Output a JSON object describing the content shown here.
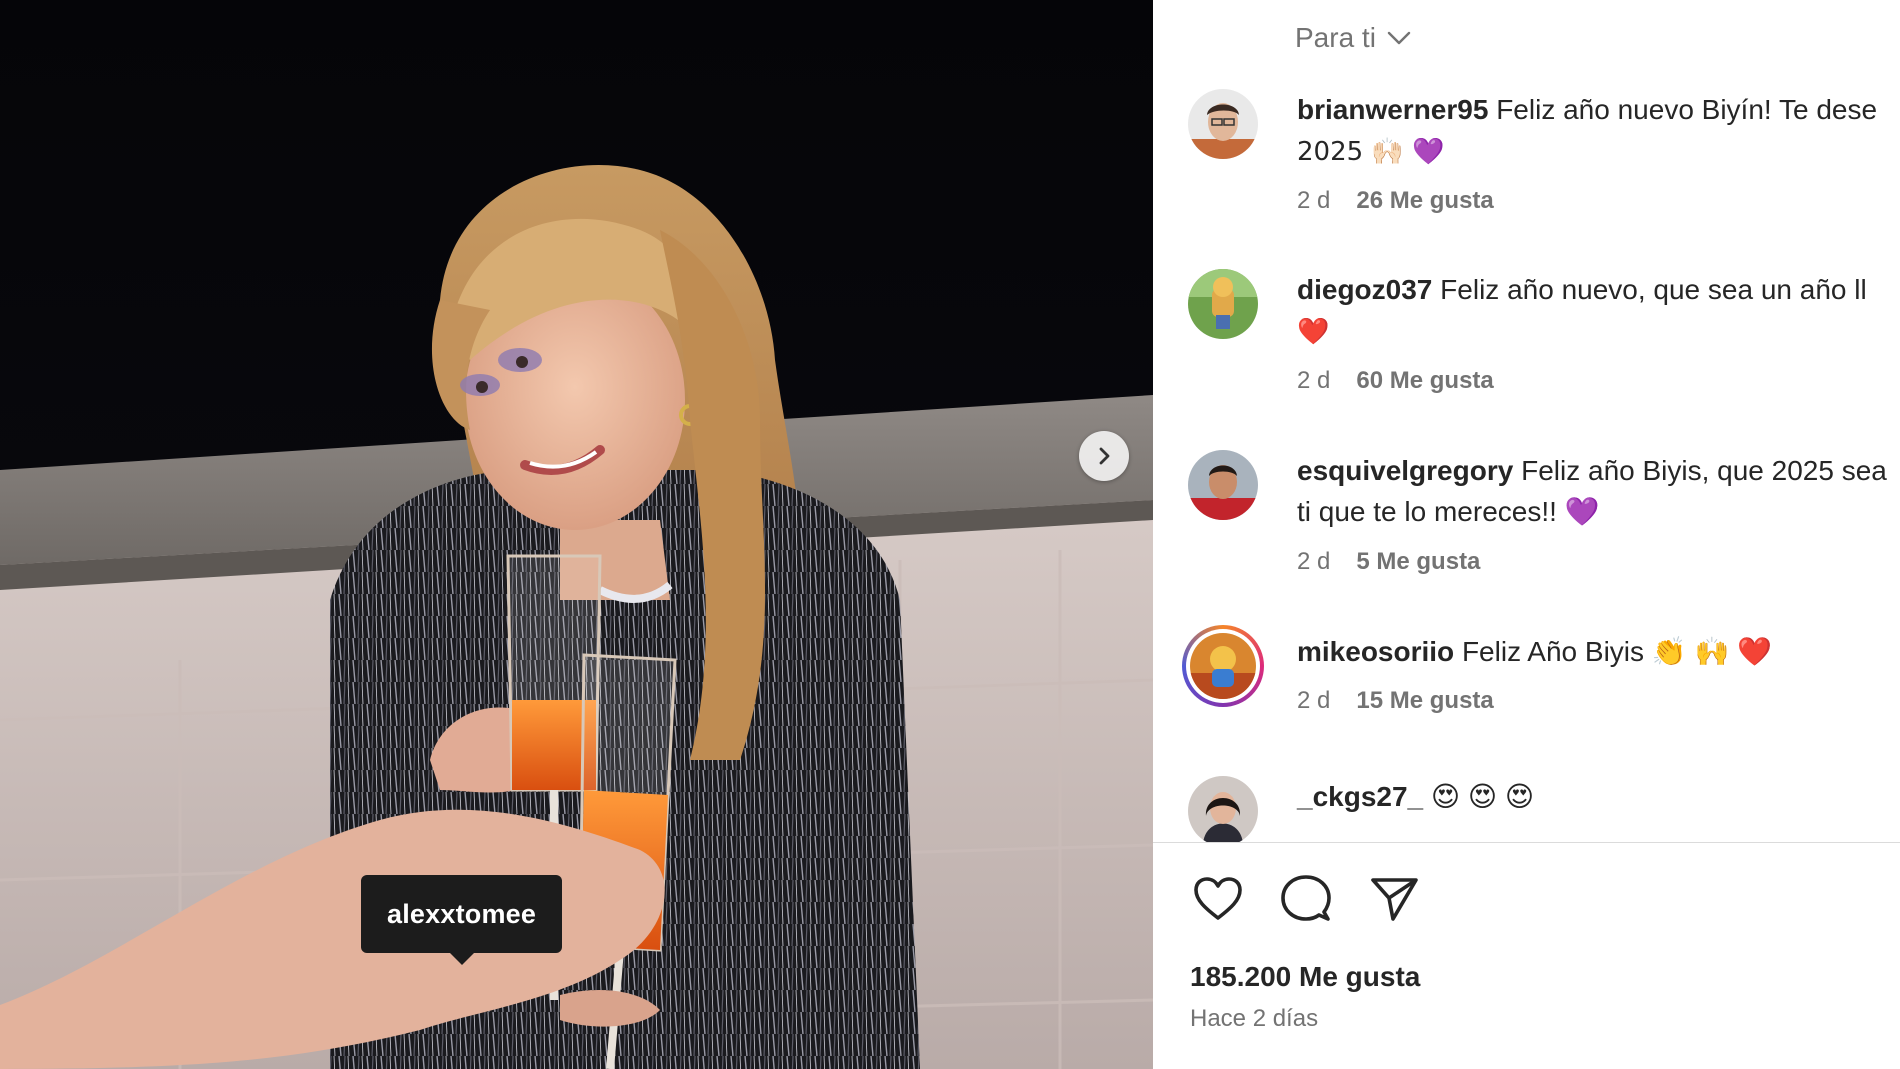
{
  "post": {
    "tag_username": "alexxtomee",
    "next_icon": "chevron-right-icon"
  },
  "sidebar": {
    "filter_label": "Para ti",
    "comments": [
      {
        "user": "brianwerner95",
        "text_line1": "Feliz año nuevo Biyín! Te dese",
        "text_line2": "2025 🙌🏻 💜",
        "age": "2 d",
        "likes": "26 Me gusta"
      },
      {
        "user": "diegoz037",
        "text_line1": "Feliz año nuevo, que sea un año ll",
        "text_line2": "❤️",
        "age": "2 d",
        "likes": "60 Me gusta"
      },
      {
        "user": "esquivelgregory",
        "text_line1": "Feliz año Biyis, que 2025 sea",
        "text_line2": "ti que te lo mereces!! 💜",
        "age": "2 d",
        "likes": "5 Me gusta"
      },
      {
        "user": "mikeosoriio",
        "text_line1": "Feliz Año Biyis 👏 🙌 ❤️",
        "age": "2 d",
        "likes": "15 Me gusta"
      },
      {
        "user": "_ckgs27_",
        "text_line1": "😍 😍 😍"
      }
    ],
    "actions": {
      "like_icon": "heart-icon",
      "comment_icon": "comment-icon",
      "share_icon": "send-icon"
    },
    "likes_total": "185.200 Me gusta",
    "time_ago": "Hace 2 días"
  },
  "colors": {
    "text": "#262626",
    "secondary": "#737373",
    "divider": "#dbdbdb",
    "tag_bg": "#1c1c1c",
    "heart_red": "#ed1c3b",
    "purple_heart": "#8a4fd8"
  }
}
